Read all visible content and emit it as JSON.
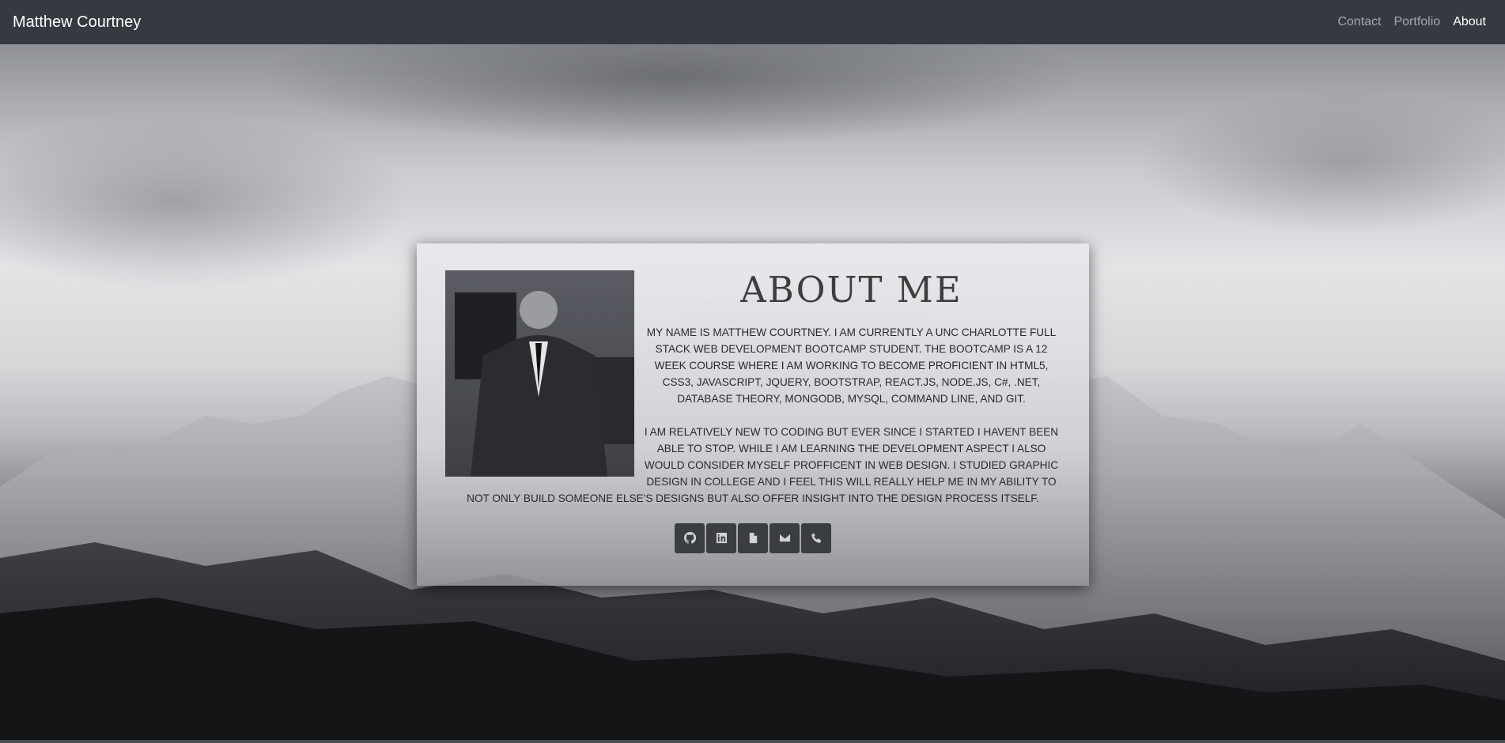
{
  "navbar": {
    "brand": "Matthew Courtney",
    "links": [
      {
        "label": "Contact",
        "active": false
      },
      {
        "label": "Portfolio",
        "active": false
      },
      {
        "label": "About",
        "active": true
      }
    ]
  },
  "about": {
    "heading": "ABOUT ME",
    "paragraphs": [
      "MY NAME IS MATTHEW COURTNEY. I AM CURRENTLY A UNC CHARLOTTE FULL STACK WEB DEVELOPMENT BOOTCAMP STUDENT. THE BOOTCAMP IS A 12 WEEK COURSE WHERE I AM WORKING TO BECOME PROFICIENT IN HTML5, CSS3, JAVASCRIPT, JQUERY, BOOTSTRAP, REACT.JS, NODE.JS, C#, .NET, DATABASE THEORY, MONGODB, MYSQL, COMMAND LINE, AND GIT.",
      "I AM RELATIVELY NEW TO CODING BUT EVER SINCE I STARTED I HAVENT BEEN ABLE TO STOP. WHILE I AM LEARNING THE DEVELOPMENT ASPECT I ALSO WOULD CONSIDER MYSELF PROFFICENT IN WEB DESIGN. I STUDIED GRAPHIC DESIGN IN COLLEGE AND I FEEL THIS WILL REALLY HELP ME IN MY ABILITY TO NOT ONLY BUILD SOMEONE ELSE'S DESIGNS BUT ALSO OFFER INSIGHT INTO THE DESIGN PROCESS ITSELF."
    ],
    "social_icons": [
      "github-icon",
      "linkedin-icon",
      "file-icon",
      "envelope-icon",
      "phone-icon"
    ]
  },
  "colors": {
    "navbar_bg": "#343a40",
    "button_bg": "#3a3d42"
  }
}
